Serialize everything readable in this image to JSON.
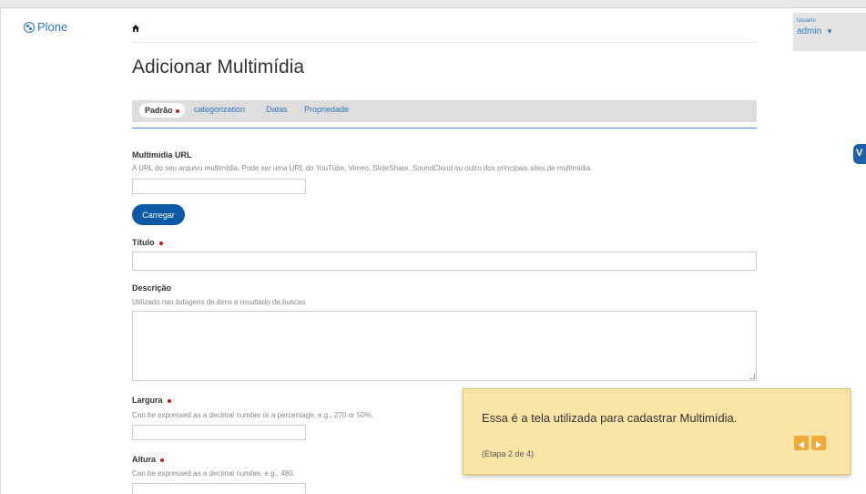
{
  "brand": {
    "name": "Plone"
  },
  "user": {
    "label": "Usuario",
    "name": "admin",
    "caret": "▼"
  },
  "page": {
    "title": "Adicionar Multimídia"
  },
  "tabs": [
    {
      "label": "Padrão",
      "required": true,
      "active": true
    },
    {
      "label": "categorization"
    },
    {
      "label": "Datas"
    },
    {
      "label": "Propriedade"
    }
  ],
  "form": {
    "url": {
      "label": "Multimídia URL",
      "help": "A URL do seu arquivo multimídia. Pode ser uma URL do YouTube, Vimeo, SlideShare, SoundCloud ou outro dos principais sites de multimídia.",
      "value": ""
    },
    "load_button": "Carregar",
    "title": {
      "label": "Título",
      "required": true,
      "value": ""
    },
    "description": {
      "label": "Descrição",
      "help": "Utilizado nas listagens de itens e resultado de buscas",
      "value": ""
    },
    "width": {
      "label": "Largura",
      "required": true,
      "help": "Can be expressed as a decimal number or a percentage, e.g., 270 or 50%.",
      "value": ""
    },
    "height": {
      "label": "Altura",
      "required": true,
      "help": "Can be expressed as a decimal number, e.g., 480.",
      "value": ""
    }
  },
  "tour": {
    "message": "Essa é a tela utilizada para cadastrar Multimídia.",
    "step": "(Etapa 2 de 4)",
    "prev_icon": "triangle-left-icon",
    "next_icon": "triangle-right-icon"
  },
  "side_badge": {
    "text": "V"
  },
  "colors": {
    "link": "#2f75c0",
    "primary_button": "#0c5aa6",
    "required": "#c4181c",
    "tour_bg": "#fbe5a6",
    "tour_nav": "#f2a93b"
  }
}
